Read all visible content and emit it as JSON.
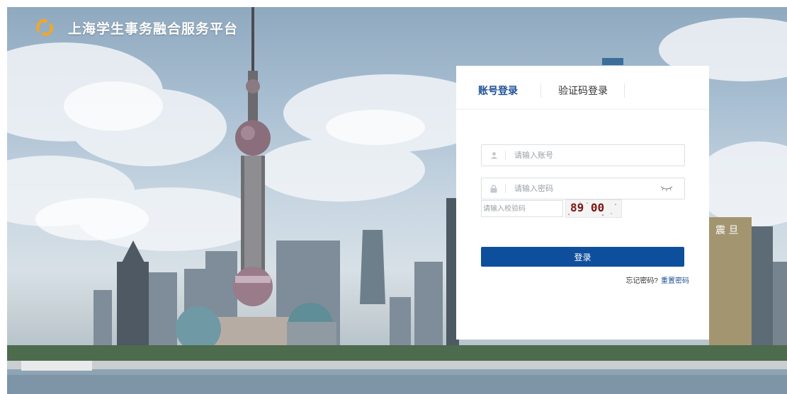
{
  "brand": {
    "title": "上海学生事务融合服务平台",
    "logo_icon": "refresh-logo-icon"
  },
  "tabs": [
    {
      "label": "账号登录",
      "active": true
    },
    {
      "label": "验证码登录",
      "active": false
    }
  ],
  "account": {
    "placeholder": "请输入账号",
    "value": "",
    "icon": "user-icon"
  },
  "password": {
    "placeholder": "请输入密码",
    "value": "",
    "icon": "lock-icon",
    "toggle_icon": "eye-closed-icon"
  },
  "captcha": {
    "placeholder": "请输入校验码",
    "value": "",
    "image_text": "89 00"
  },
  "login": {
    "label": "登录"
  },
  "forgot": {
    "question": "忘记密码?",
    "link": "重置密码"
  },
  "colors": {
    "primary": "#0e4f9d",
    "tab_active": "#1f4f96",
    "logo_orange": "#f5a623"
  }
}
